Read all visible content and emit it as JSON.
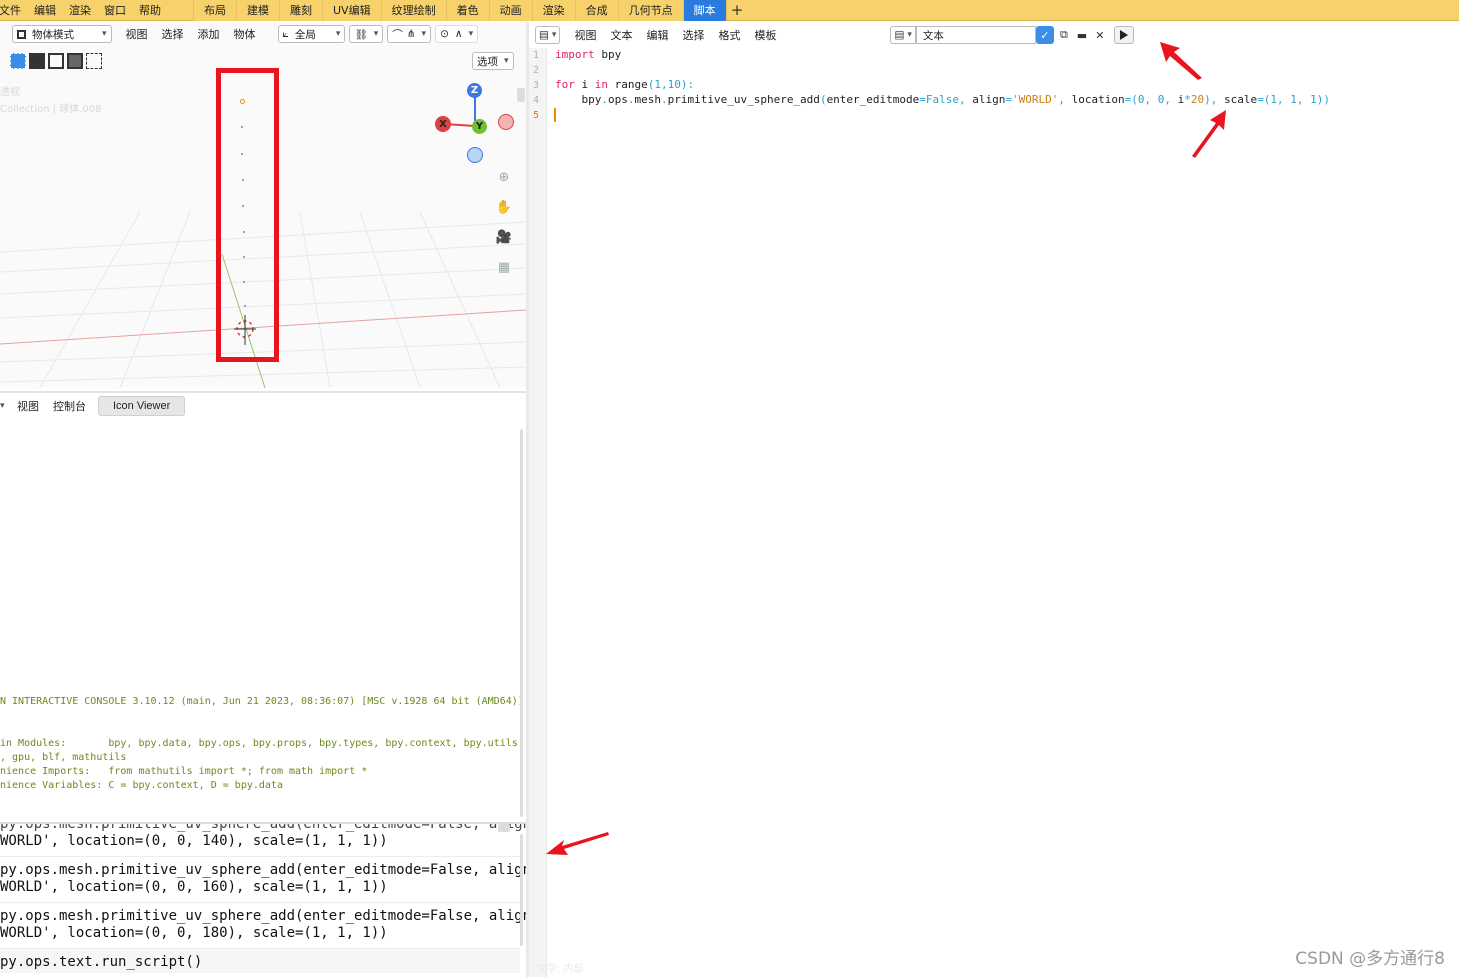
{
  "menu": {
    "items": [
      "文件",
      "编辑",
      "渲染",
      "窗口",
      "帮助"
    ]
  },
  "workspaces": {
    "tabs": [
      "布局",
      "建模",
      "雕刻",
      "UV编辑",
      "纹理绘制",
      "着色",
      "动画",
      "渲染",
      "合成",
      "几何节点",
      "脚本"
    ],
    "active": "脚本",
    "add_label": "+"
  },
  "viewport": {
    "mode_label": "物体模式",
    "menus": [
      "视图",
      "选择",
      "添加",
      "物体"
    ],
    "transform_label": "全局",
    "options_label": "选项",
    "overlay_line1": "透视",
    "overlay_line2": "Collection | 球体.008",
    "gizmo": {
      "x": "X",
      "y": "Y",
      "z": "Z"
    }
  },
  "console": {
    "menus": [
      "视图",
      "控制台"
    ],
    "tab_label": "Icon Viewer",
    "banner": "N INTERACTIVE CONSOLE 3.10.12 (main, Jun 21 2023, 08:36:07) [MSC v.1928 64 bit (AMD64)]",
    "modules_line1": "in Modules:       bpy, bpy.data, bpy.ops, bpy.props, bpy.types, bpy.context, bpy.utils",
    "modules_line2": ", gpu, blf, mathutils",
    "imports_line": "nience Imports:   from mathutils import *; from math import *",
    "variables_line": "nience Variables: C = bpy.context, D = bpy.data"
  },
  "output": {
    "lines": [
      "py.ops.mesh.primitive_uv_sphere_add(enter_editmode=False, align=",
      "WORLD', location=(0, 0, 140), scale=(1, 1, 1))",
      "py.ops.mesh.primitive_uv_sphere_add(enter_editmode=False, align=",
      "WORLD', location=(0, 0, 160), scale=(1, 1, 1))",
      "py.ops.mesh.primitive_uv_sphere_add(enter_editmode=False, align=",
      "WORLD', location=(0, 0, 180), scale=(1, 1, 1))",
      "py.ops.text.run_script()"
    ]
  },
  "editor": {
    "menus": [
      "视图",
      "文本",
      "编辑",
      "选择",
      "格式",
      "模板"
    ],
    "text_name": "文本",
    "line_numbers": [
      "1",
      "2",
      "3",
      "4",
      "5"
    ],
    "code": {
      "l1_kw": "import",
      "l1_rest": " bpy",
      "l3_kw": "for",
      "l3_a": " i ",
      "l3_in": "in",
      "l3_b": " range",
      "l3_p1": "(",
      "l3_n1": "1",
      "l3_c": ",",
      "l3_n2": "10",
      "l3_p2": "):",
      "l4_a": "    bpy",
      "l4_d1": ".",
      "l4_b": "ops",
      "l4_d2": ".",
      "l4_c": "mesh",
      "l4_d3": ".",
      "l4_d": "primitive_uv_sphere_add",
      "l4_p1": "(",
      "l4_e": "enter_editmode",
      "l4_eq1": "=",
      "l4_false": "False",
      "l4_c1": ", ",
      "l4_f": "align",
      "l4_eq2": "=",
      "l4_world": "'WORLD'",
      "l4_c2": ", ",
      "l4_g": "location",
      "l4_eq3": "=",
      "l4_p2": "(",
      "l4_z1": "0",
      "l4_c3": ", ",
      "l4_z2": "0",
      "l4_c4": ", ",
      "l4_h": "i",
      "l4_mul": "*",
      "l4_twenty": "20",
      "l4_p3": "), ",
      "l4_i": "scale",
      "l4_eq4": "=",
      "l4_p4": "(",
      "l4_o1": "1",
      "l4_c5": ", ",
      "l4_o2": "1",
      "l4_c6": ", ",
      "l4_o3": "1",
      "l4_p5": "))"
    },
    "status": "文字: 内部"
  },
  "watermark": "CSDN @多方通行8",
  "colors": {
    "topbar": "#f7d16a",
    "active_tab": "#2a7be0",
    "highlight_box": "#e8141e",
    "arrow": "#e8141e",
    "console_text": "#6b8a1a",
    "keyword": "#e0246b",
    "number": "#2aa0c8",
    "string": "#cf7f17"
  }
}
